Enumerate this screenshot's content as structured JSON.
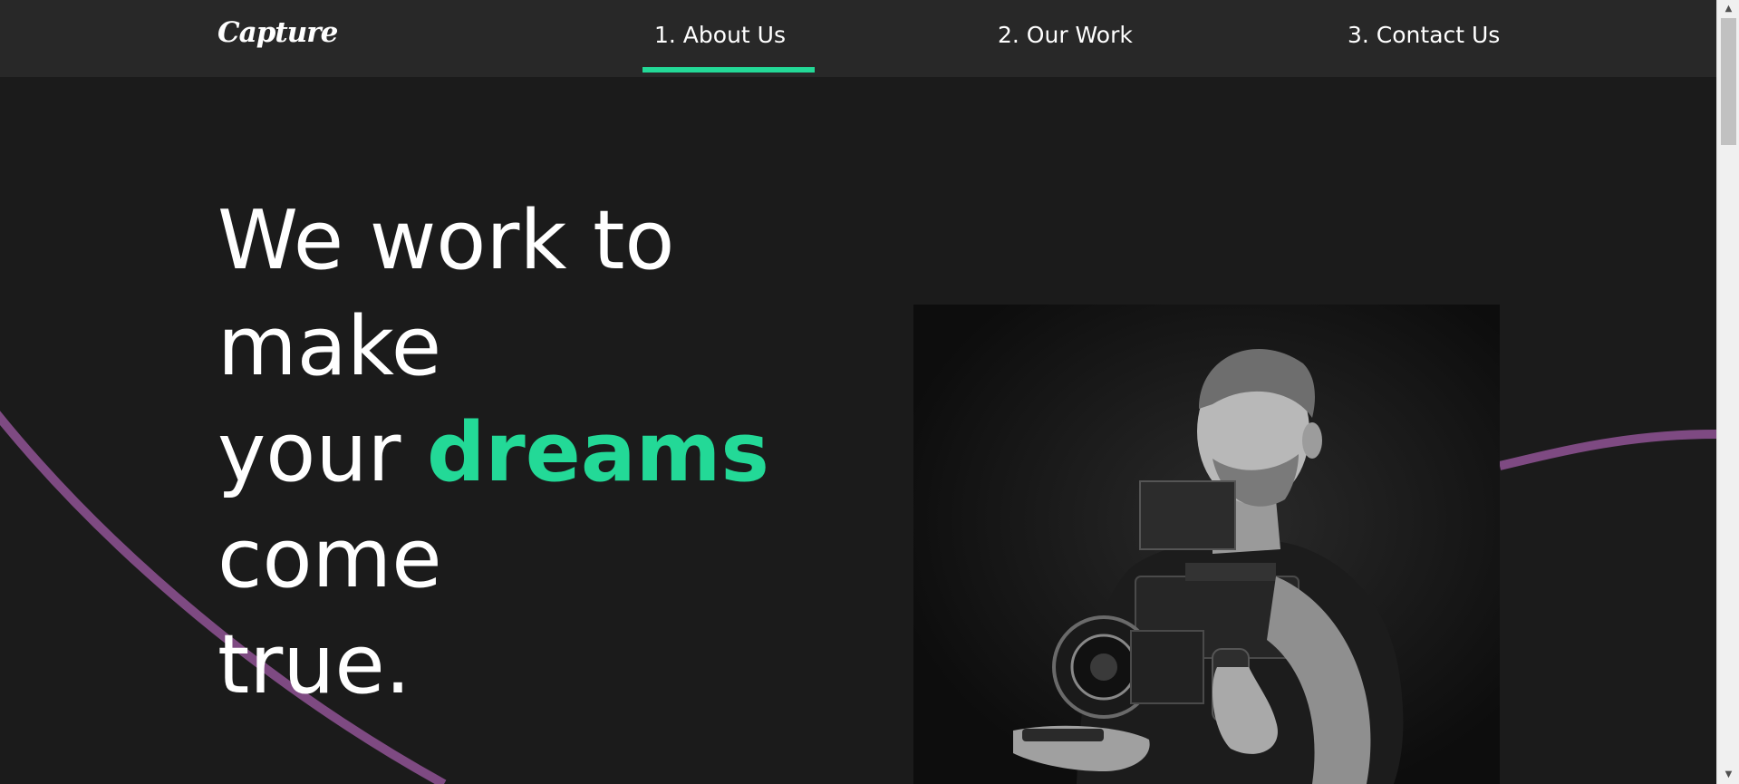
{
  "nav": {
    "logo": "Capture",
    "links": [
      {
        "label": "1. About Us",
        "active": true
      },
      {
        "label": "2. Our Work",
        "active": false
      },
      {
        "label": "3. Contact Us",
        "active": false
      }
    ]
  },
  "hero": {
    "line1": "We work to",
    "line2": "make",
    "line3_prefix": "your ",
    "line3_accent": "dreams",
    "line4": "come",
    "line5": "true.",
    "image": "photographer-with-camera-rig (black and white)"
  },
  "colors": {
    "background": "#1b1b1b",
    "navbar": "#282828",
    "accent": "#23d997",
    "wave": "#7e4a82"
  }
}
